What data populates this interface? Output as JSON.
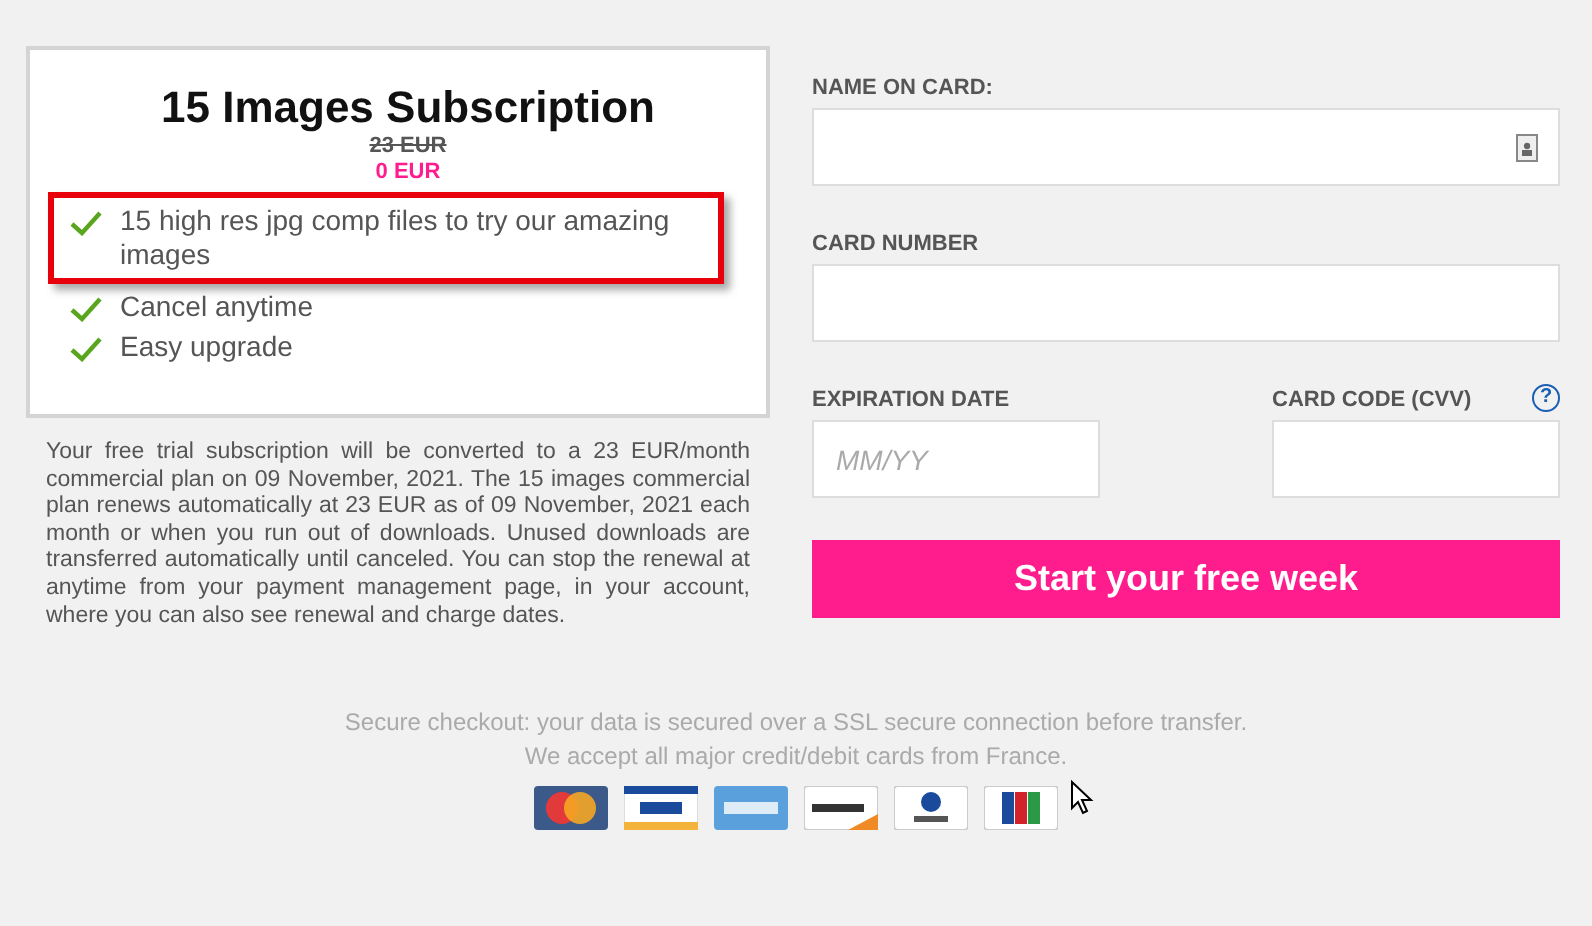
{
  "plan": {
    "title": "15 Images Subscription",
    "old_price": "23 EUR",
    "price": "0 EUR",
    "features": [
      {
        "text": "15 high res jpg comp files to try our amazing images",
        "highlighted": true
      },
      {
        "text": "Cancel anytime",
        "highlighted": false
      },
      {
        "text": "Easy upgrade",
        "highlighted": false
      }
    ]
  },
  "terms": "Your free trial subscription will be converted to a 23 EUR/month commercial plan on 09 November, 2021. The 15 images commercial plan renews automatically at 23 EUR as of 09 November, 2021 each month or when you run out of downloads. Unused downloads are transferred automatically until canceled. You can stop the renewal at anytime from your payment management page, in your account, where you can also see renewal and charge dates.",
  "form": {
    "name_label": "NAME ON CARD:",
    "number_label": "CARD NUMBER",
    "expiry_label": "EXPIRATION DATE",
    "expiry": {
      "placeholder": "MM/YY"
    },
    "cvv_label": "CARD CODE (CVV)",
    "help": "?",
    "submit": "Start your free week"
  },
  "footer": {
    "lines": [
      "Secure checkout: your data is secured over a SSL secure connection before transfer.",
      "We accept all major credit/debit cards from France."
    ],
    "cards": [
      {
        "kind": "mastercard"
      },
      {
        "kind": "visa"
      },
      {
        "kind": "amex"
      },
      {
        "kind": "discover"
      },
      {
        "kind": "diners"
      },
      {
        "kind": "jcb"
      }
    ]
  }
}
